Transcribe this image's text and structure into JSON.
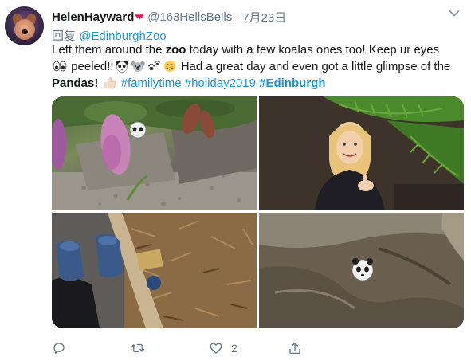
{
  "user": {
    "name": "HelenHayward",
    "handle": "@163HellsBells",
    "separator": "·",
    "time": "7月23日"
  },
  "reply": {
    "prefix": "回复",
    "mention": "@EdinburghZoo"
  },
  "tweet": {
    "t1": "Left them around the ",
    "t2": "zoo",
    "t3": " today with a few koalas ones too! Keep ur eyes",
    "t4": " peeled!!",
    "t5": " Had a great day and even got a little glimpse of the",
    "t6": "Pandas!",
    "tag1": "#familytime",
    "tag2": "#holiday2019",
    "tag3": "#Edinburgh"
  },
  "icons": {
    "heart_emoji": "red-heart-icon",
    "eyes": "eyes-emoji-icon",
    "panda": "panda-emoji-icon",
    "koala": "koala-emoji-icon",
    "paws": "paw-prints-emoji-icon",
    "smile": "smiling-face-emoji-icon",
    "thumbs": "thumbs-up-emoji-icon",
    "more": "chevron-down-icon",
    "reply": "reply-icon",
    "retweet": "retweet-icon",
    "like": "heart-icon",
    "share": "share-icon"
  },
  "photos": [
    {
      "id": "photo-1",
      "subject": "purple buddleia flowers over gravel with a painted panda stone"
    },
    {
      "id": "photo-2",
      "subject": "smiling girl with thumbs up beside ferns"
    },
    {
      "id": "photo-3",
      "subject": "blue shoes on wood chips next to a wooden post"
    },
    {
      "id": "photo-4",
      "subject": "painted panda stone on a weathered rock"
    }
  ],
  "actions": {
    "likes": "2"
  },
  "colors": {
    "text": "#14171a",
    "secondary": "#657786",
    "link": "#1b95e0",
    "heart": "#e0245e"
  }
}
